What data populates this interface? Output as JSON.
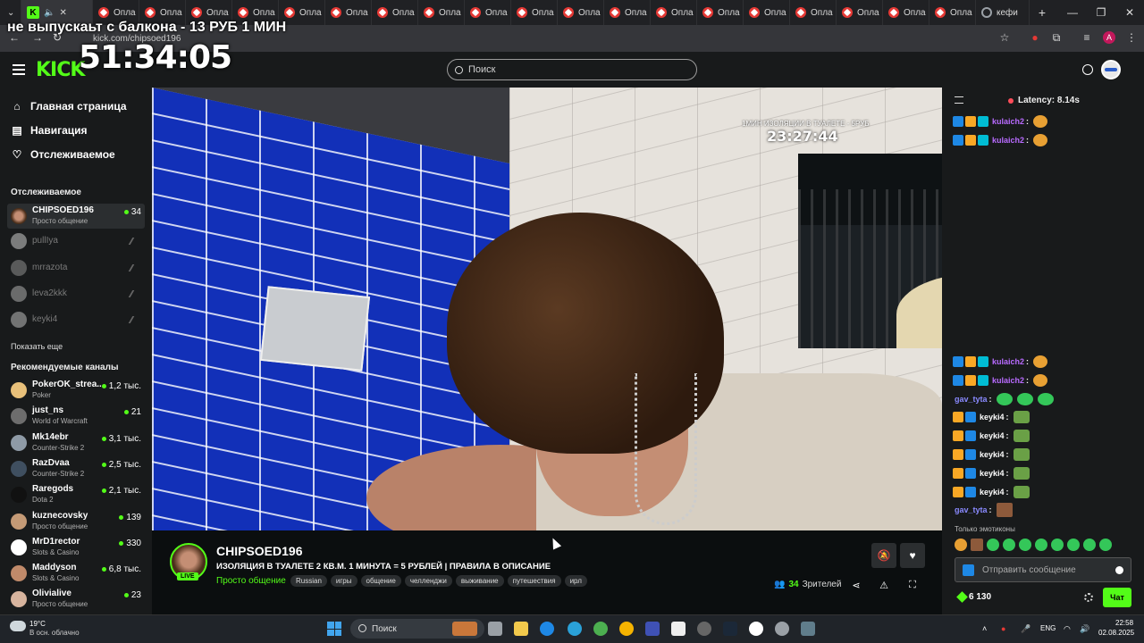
{
  "browser": {
    "tabs": [
      {
        "label": "Опла",
        "favicon": "red-star-icon"
      },
      {
        "label": "Опла",
        "favicon": "red-star-icon"
      },
      {
        "label": "Опла",
        "favicon": "red-star-icon"
      },
      {
        "label": "Опла",
        "favicon": "red-star-icon"
      },
      {
        "label": "Опла",
        "favicon": "red-star-icon"
      },
      {
        "label": "Опла",
        "favicon": "red-star-icon"
      },
      {
        "label": "Опла",
        "favicon": "red-star-icon"
      },
      {
        "label": "Опла",
        "favicon": "red-star-icon"
      },
      {
        "label": "Опла",
        "favicon": "red-star-icon"
      },
      {
        "label": "Опла",
        "favicon": "red-star-icon"
      },
      {
        "label": "Опла",
        "favicon": "red-star-icon"
      },
      {
        "label": "Опла",
        "favicon": "red-star-icon"
      },
      {
        "label": "Опла",
        "favicon": "red-star-icon"
      },
      {
        "label": "Опла",
        "favicon": "red-star-icon"
      },
      {
        "label": "Опла",
        "favicon": "red-star-icon"
      },
      {
        "label": "Опла",
        "favicon": "red-star-icon"
      },
      {
        "label": "Опла",
        "favicon": "red-star-icon"
      },
      {
        "label": "Опла",
        "favicon": "red-star-icon"
      },
      {
        "label": "Опла",
        "favicon": "red-star-icon"
      }
    ],
    "last_tab": "кефи",
    "new_tab": "+",
    "url": "kick.com/chipsoed196",
    "profile_initial": "A"
  },
  "overlay": {
    "banner": "не выпускаьт с балкона - 13 РУБ 1 МИН",
    "timer": "51:34:05"
  },
  "header": {
    "logo": "KICK",
    "search_placeholder": "Поиск"
  },
  "sidebar": {
    "nav": [
      {
        "label": "Главная страница",
        "icon": "home-icon"
      },
      {
        "label": "Навигация",
        "icon": "compass-icon"
      },
      {
        "label": "Отслеживаемое",
        "icon": "heart-icon"
      }
    ],
    "following_title": "Отслеживаемое",
    "following": [
      {
        "name": "CHIPSOED196",
        "category": "Просто общение",
        "viewers": "34",
        "live": true
      },
      {
        "name": "pullIya",
        "live": false
      },
      {
        "name": "mrrazota",
        "live": false
      },
      {
        "name": "leva2kkk",
        "live": false
      },
      {
        "name": "keyki4",
        "live": false
      }
    ],
    "show_more": "Показать еще",
    "recommended_title": "Рекомендуемые каналы",
    "recommended": [
      {
        "name": "PokerOK_strea...",
        "category": "Poker",
        "viewers": "1,2 тыс."
      },
      {
        "name": "just_ns",
        "category": "World of Warcraft",
        "viewers": "21"
      },
      {
        "name": "Mk14ebr",
        "category": "Counter-Strike 2",
        "viewers": "3,1 тыс."
      },
      {
        "name": "RazDvaa",
        "category": "Counter-Strike 2",
        "viewers": "2,5 тыс."
      },
      {
        "name": "Raregods",
        "category": "Dota 2",
        "viewers": "2,1 тыс."
      },
      {
        "name": "kuznecovsky",
        "category": "Просто общение",
        "viewers": "139"
      },
      {
        "name": "MrD1rector",
        "category": "Slots & Casino",
        "viewers": "330"
      },
      {
        "name": "Maddyson",
        "category": "Slots & Casino",
        "viewers": "6,8 тыс."
      },
      {
        "name": "Olivialive",
        "category": "Просто общение",
        "viewers": "23"
      }
    ]
  },
  "video": {
    "timer_label": "1МИН ИЗОЛЯЦИИ В ТУАЛЕТЕ - 5РУБ",
    "timer": "23:27:44"
  },
  "stream": {
    "channel": "CHIPSOED196",
    "live_badge": "LIVE",
    "title": "ИЗОЛЯЦИЯ В ТУАЛЕТЕ 2 КВ.М. 1 МИНУТА = 5 РУБЛЕЙ | ПРАВИЛА В ОПИСАНИЕ",
    "category": "Просто общение",
    "tags": [
      "Russian",
      "игры",
      "общение",
      "челленджи",
      "выживание",
      "путешествия",
      "ирл"
    ],
    "viewers_count": "34",
    "viewers_label": "Зрителей"
  },
  "chat": {
    "latency": "Latency: 8.14s",
    "messages_top": [
      {
        "user": "kulaich2",
        "color": "#b86bff"
      },
      {
        "user": "kulaich2",
        "color": "#b86bff"
      }
    ],
    "messages": [
      {
        "user": "kulaich2",
        "color": "#b86bff",
        "badges": 3,
        "emote": "orange"
      },
      {
        "user": "kulaich2",
        "color": "#b86bff",
        "badges": 3,
        "emote": "orange"
      },
      {
        "user": "gav_tyta",
        "color": "#8a8aff",
        "badges": 0,
        "emote": "green3"
      },
      {
        "user": "keyki4",
        "color": "#fff",
        "badges": 2,
        "emote": "green"
      },
      {
        "user": "keyki4",
        "color": "#fff",
        "badges": 2,
        "emote": "green"
      },
      {
        "user": "keyki4",
        "color": "#fff",
        "badges": 2,
        "emote": "green"
      },
      {
        "user": "keyki4",
        "color": "#fff",
        "badges": 2,
        "emote": "green"
      },
      {
        "user": "keyki4",
        "color": "#fff",
        "badges": 2,
        "emote": "green"
      },
      {
        "user": "gav_tyta",
        "color": "#8a8aff",
        "badges": 0,
        "emote": "brown"
      }
    ],
    "emote_only": "Только эмотиконы",
    "input_placeholder": "Отправить сообщение",
    "points": "6 130",
    "send_label": "Чат"
  },
  "taskbar": {
    "weather_temp": "19°C",
    "weather_desc": "В осн. облачно",
    "search_label": "Поиск",
    "lang": "ENG",
    "time": "22:58",
    "date": "02.08.2025"
  },
  "colors": {
    "kick_green": "#53fc18",
    "bg_dark": "#0b0e0f",
    "panel": "#181a1b"
  }
}
